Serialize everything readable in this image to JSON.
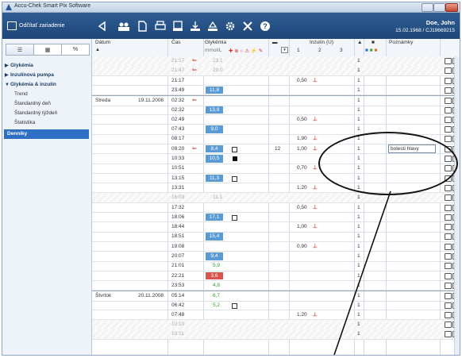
{
  "window": {
    "title": "Accu-Chek Smart Pix Software"
  },
  "toolbar": {
    "open_device_label": "Odčítať zariadenie",
    "icons": [
      "back-icon",
      "users-icon",
      "document-icon",
      "print-icon",
      "device-icon",
      "export-icon",
      "upload-icon",
      "gear-icon",
      "tools-icon",
      "help-icon"
    ]
  },
  "patient": {
    "name": "Doe, John",
    "dob": "15.02.1968 / CJ19669215"
  },
  "sidebar": {
    "tabs": [
      "☰",
      "▦",
      "%"
    ],
    "items": [
      {
        "label": "Glykémia",
        "type": "group",
        "tri": "▶"
      },
      {
        "label": "Inzulínová pumpa",
        "type": "group",
        "tri": "▶"
      },
      {
        "label": "Glykémia & inzulín",
        "type": "group",
        "tri": "▼"
      },
      {
        "label": "Trend",
        "type": "sub"
      },
      {
        "label": "Štandardný deň",
        "type": "sub"
      },
      {
        "label": "Štandardný týždeň",
        "type": "sub"
      },
      {
        "label": "Štatistika",
        "type": "sub"
      },
      {
        "label": "Denníky",
        "type": "selected"
      }
    ]
  },
  "table": {
    "headers": {
      "datum": "Dátum",
      "cas": "Čas",
      "glykemia": "Glykémia",
      "glykemia_unit": "mmol/L",
      "inzulin": "Inzulín (U)",
      "insulin_cols": [
        "1",
        "2",
        "3"
      ],
      "poznamky": "Poznámky"
    },
    "rows": [
      {
        "time": "21:17",
        "faded": true,
        "glu": "23.1",
        "gluColor": "",
        "ins": "",
        "k": "1"
      },
      {
        "time": "21:47",
        "faded": true,
        "glu": "20.0",
        "gluColor": "",
        "ins": "",
        "k": "1"
      },
      {
        "time": "21:17",
        "glu": "",
        "ins": "0,50",
        "k": "1"
      },
      {
        "time": "23:49",
        "glu": "11,8",
        "gluColor": "#5b9bd5",
        "ins": "",
        "k": "1"
      },
      {
        "day": "Streda",
        "date": "19.11.2008",
        "time": "02:32",
        "glu": "",
        "ins": "",
        "k": "1"
      },
      {
        "time": "02:32",
        "glu": "13,9",
        "gluColor": "#5b9bd5",
        "ins": "",
        "k": "1"
      },
      {
        "time": "02:49",
        "glu": "",
        "ins": "0,50",
        "k": "1"
      },
      {
        "time": "07:43",
        "glu": "9,0",
        "gluColor": "#5b9bd5",
        "ins": "",
        "k": "1"
      },
      {
        "time": "08:17",
        "glu": "",
        "ins": "1,90",
        "k": "1"
      },
      {
        "time": "09:20",
        "glu": "8,4",
        "gluColor": "#5b9bd5",
        "carb": "12",
        "ins": "1,00",
        "k": "1",
        "note": "bolesti hlavy"
      },
      {
        "time": "10:33",
        "glu": "10,5",
        "gluColor": "#5b9bd5",
        "ins": "",
        "k": "1"
      },
      {
        "time": "10:51",
        "glu": "",
        "ins": "0,70",
        "k": "1"
      },
      {
        "time": "13:15",
        "glu": "11,3",
        "gluColor": "#5b9bd5",
        "ins": "",
        "k": "1"
      },
      {
        "time": "13:31",
        "glu": "",
        "ins": "1,20",
        "k": "1"
      },
      {
        "time": "16:03",
        "faded": true,
        "glu": "11,1",
        "gluColor": "",
        "ins": "",
        "k": "1"
      },
      {
        "time": "17:32",
        "glu": "",
        "ins": "0,50",
        "k": "1"
      },
      {
        "time": "18:06",
        "glu": "17,1",
        "gluColor": "#5b9bd5",
        "ins": "",
        "k": "1"
      },
      {
        "time": "18:44",
        "glu": "",
        "ins": "1,00",
        "k": "1"
      },
      {
        "time": "18:51",
        "glu": "15,4",
        "gluColor": "#5b9bd5",
        "ins": "",
        "k": "1"
      },
      {
        "time": "19:08",
        "glu": "",
        "ins": "0,90",
        "k": "1"
      },
      {
        "time": "20:07",
        "glu": "9,4",
        "gluColor": "#5b9bd5",
        "ins": "",
        "k": "1"
      },
      {
        "time": "21:01",
        "glu": "5,9",
        "gluColor": "green",
        "ins": "",
        "k": "1"
      },
      {
        "time": "22:21",
        "glu": "3,6",
        "gluColor": "#d9534f",
        "ins": "",
        "k": "1"
      },
      {
        "time": "23:53",
        "glu": "4,8",
        "gluColor": "green",
        "ins": "",
        "k": "1"
      },
      {
        "day": "Štvrtok",
        "date": "20.11.2008",
        "time": "05:14",
        "glu": "6,7",
        "gluColor": "green",
        "ins": "",
        "k": "1"
      },
      {
        "time": "06:42",
        "glu": "5,2",
        "gluColor": "green",
        "ins": "",
        "k": "1"
      },
      {
        "time": "07:48",
        "glu": "",
        "ins": "1,20",
        "k": "1"
      },
      {
        "time": "10:10",
        "faded": true,
        "glu": "",
        "ins": "",
        "k": "1"
      },
      {
        "time": "10:11",
        "faded": true,
        "glu": "",
        "ins": "",
        "k": "1"
      }
    ]
  }
}
